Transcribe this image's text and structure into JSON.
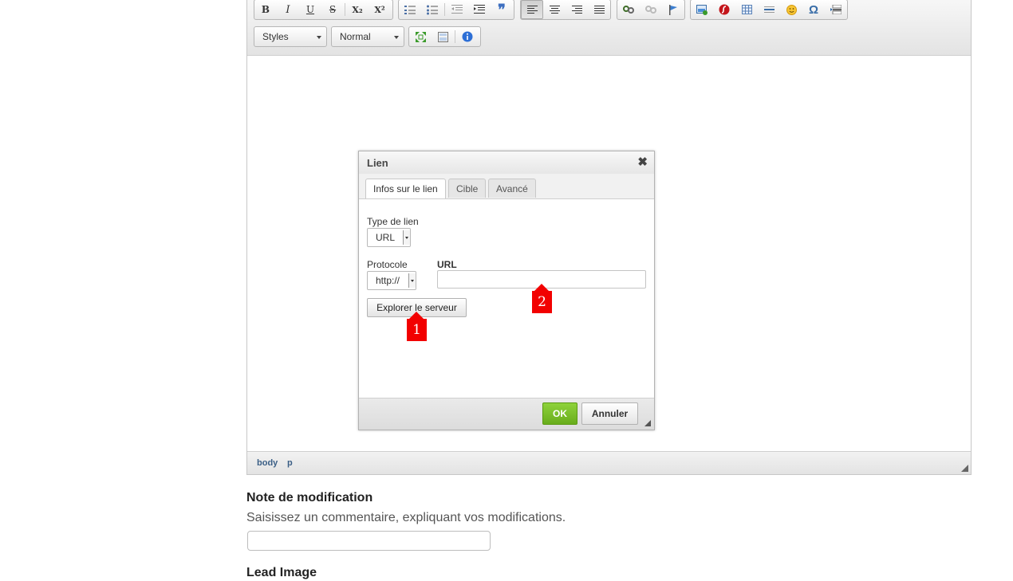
{
  "editor": {
    "toolbar": {
      "row1_icons": [
        "bold-icon",
        "italic-icon",
        "underline-icon",
        "strikethrough-icon",
        "subscript-icon",
        "superscript-icon",
        "numbered-list-icon",
        "bulleted-list-icon",
        "outdent-icon",
        "indent-icon",
        "blockquote-icon",
        "align-left-icon",
        "align-center-icon",
        "align-right-icon",
        "justify-icon",
        "link-icon",
        "unlink-icon",
        "anchor-icon",
        "image-icon",
        "flash-icon",
        "table-icon",
        "horizontal-rule-icon",
        "smiley-icon",
        "special-char-icon",
        "page-break-icon"
      ],
      "bold_glyph": "B",
      "italic_glyph": "I",
      "underline_glyph": "U",
      "strike_glyph": "S",
      "sub_glyph": "X₂",
      "sup_glyph": "X²",
      "quote_glyph": "❞",
      "omega_glyph": "Ω",
      "styles_combo": "Styles",
      "format_combo": "Normal"
    },
    "statusbar": {
      "path": [
        "body",
        "p"
      ]
    }
  },
  "dialog": {
    "title": "Lien",
    "close_glyph": "✖",
    "tabs": [
      {
        "label": "Infos sur le lien",
        "active": true
      },
      {
        "label": "Cible",
        "active": false
      },
      {
        "label": "Avancé",
        "active": false
      }
    ],
    "link_type_label": "Type de lien",
    "link_type_value": "URL",
    "protocol_label": "Protocole",
    "protocol_value": "http://",
    "url_label": "URL",
    "url_value": "",
    "browse_button": "Explorer le serveur",
    "ok_button": "OK",
    "cancel_button": "Annuler"
  },
  "markers": [
    "1",
    "2"
  ],
  "form": {
    "note_title": "Note de modification",
    "note_help": "Saisissez un commentaire, expliquant vos modifications.",
    "note_value": "",
    "lead_image_title": "Lead Image"
  },
  "colors": {
    "marker": "#f20000",
    "ok_button": "#7cc02b",
    "path_text": "#3b5f86"
  }
}
